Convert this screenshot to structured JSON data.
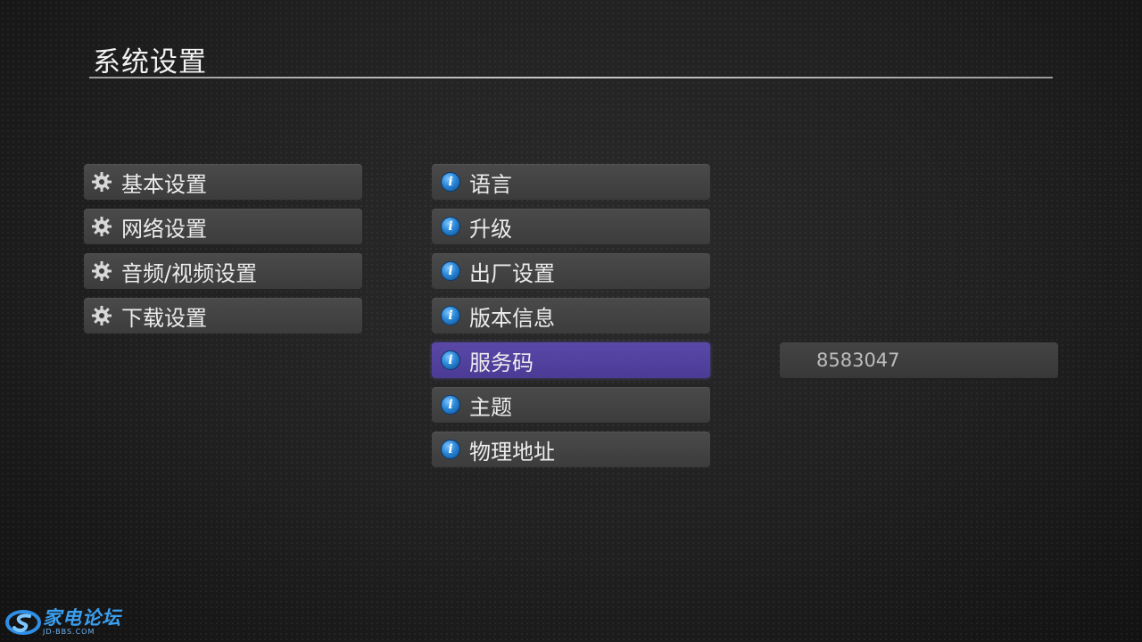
{
  "page": {
    "title": "系统设置"
  },
  "left_menu": [
    {
      "label": "基本设置",
      "icon": "gear-icon"
    },
    {
      "label": "网络设置",
      "icon": "gear-icon"
    },
    {
      "label": "音频/视频设置",
      "icon": "gear-icon"
    },
    {
      "label": "下载设置",
      "icon": "gear-icon"
    }
  ],
  "sub_menu": [
    {
      "label": "语言",
      "icon": "info-icon"
    },
    {
      "label": "升级",
      "icon": "info-icon"
    },
    {
      "label": "出厂设置",
      "icon": "info-icon"
    },
    {
      "label": "版本信息",
      "icon": "info-icon"
    },
    {
      "label": "服务码",
      "icon": "info-icon",
      "selected": true
    },
    {
      "label": "主题",
      "icon": "info-icon"
    },
    {
      "label": "物理地址",
      "icon": "info-icon"
    }
  ],
  "detail": {
    "service_code": "8583047"
  },
  "watermark": {
    "name": "家电论坛",
    "site": "JD-BBS.COM"
  },
  "colors": {
    "selected": "#5a48a8",
    "item_bg": "#444444",
    "info_icon": "#2a86d6",
    "watermark": "#3a9ff0"
  }
}
